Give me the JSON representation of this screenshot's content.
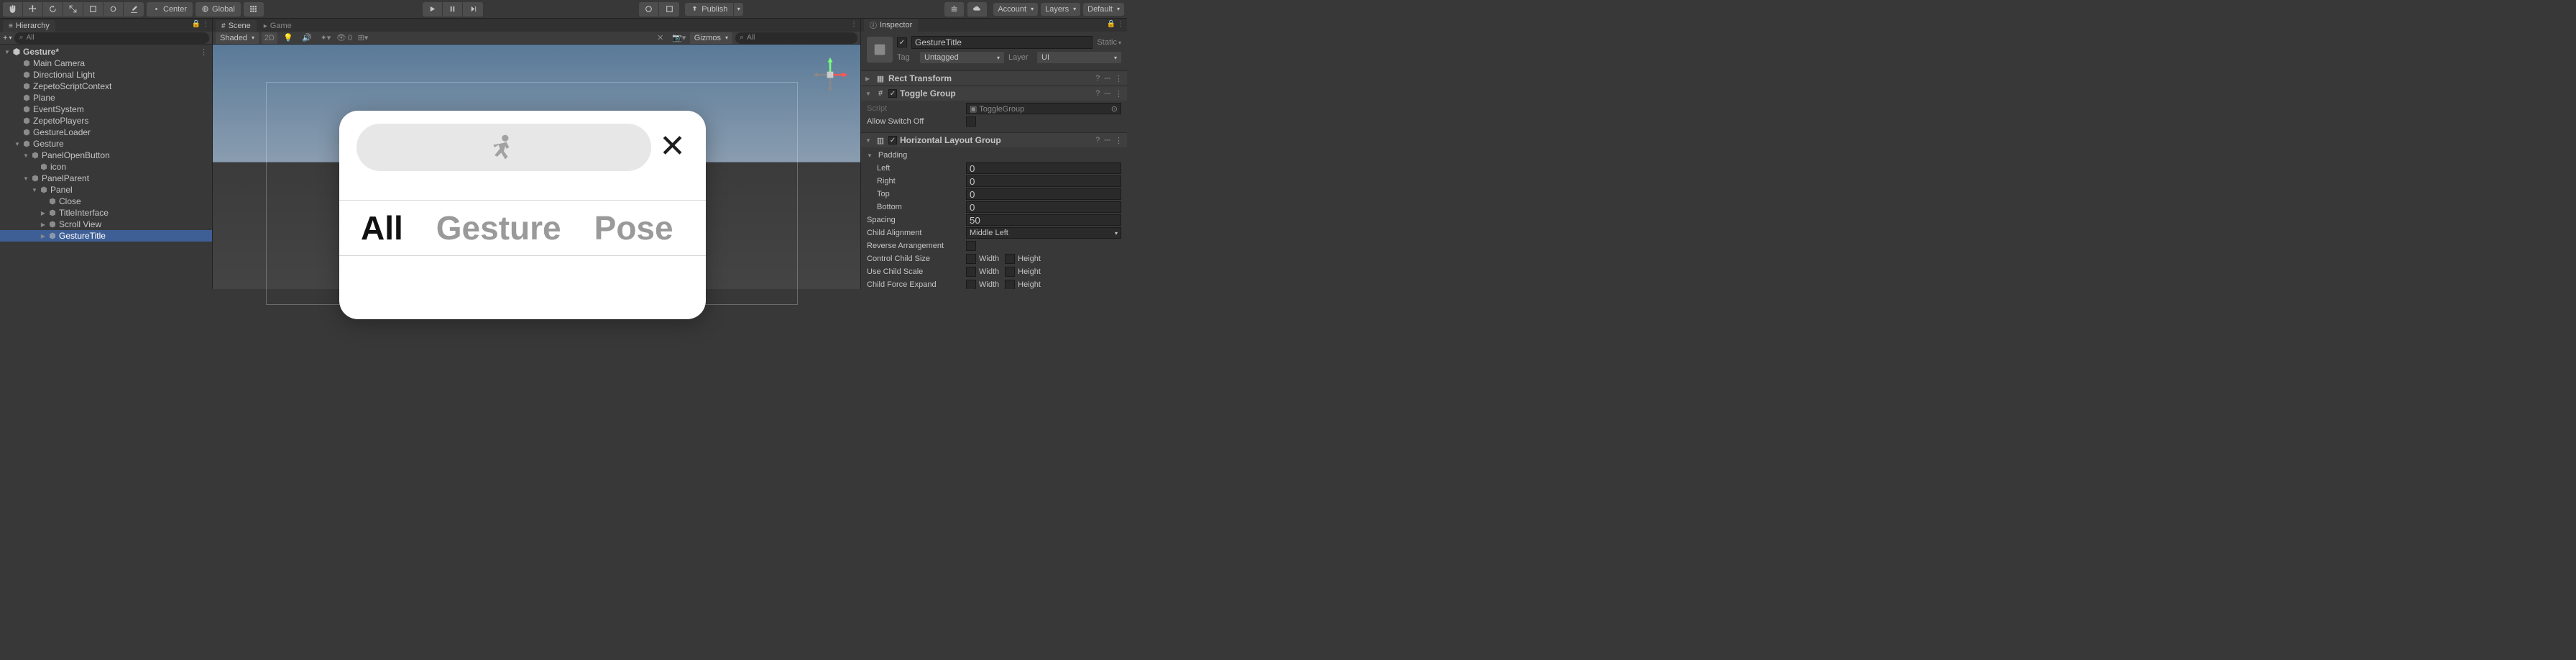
{
  "toolbar": {
    "center": "Center",
    "global": "Global",
    "publish": "Publish",
    "account": "Account",
    "layers": "Layers",
    "layout": "Default"
  },
  "hierarchy": {
    "tab": "Hierarchy",
    "search_placeholder": "All",
    "scene": "Gesture*",
    "items": [
      {
        "label": "Main Camera",
        "pad": 1
      },
      {
        "label": "Directional Light",
        "pad": 1
      },
      {
        "label": "ZepetoScriptContext",
        "pad": 1
      },
      {
        "label": "Plane",
        "pad": 1
      },
      {
        "label": "EventSystem",
        "pad": 1
      },
      {
        "label": "ZepetoPlayers",
        "pad": 1
      },
      {
        "label": "GestureLoader",
        "pad": 1
      },
      {
        "label": "Gesture",
        "pad": 1,
        "fold": true
      },
      {
        "label": "PanelOpenButton",
        "pad": 2,
        "fold": true
      },
      {
        "label": "icon",
        "pad": 3
      },
      {
        "label": "PanelParent",
        "pad": 2,
        "fold": true
      },
      {
        "label": "Panel",
        "pad": 3,
        "fold": true
      },
      {
        "label": "Close",
        "pad": 4
      },
      {
        "label": "TitleInterface",
        "pad": 4,
        "fold": false
      },
      {
        "label": "Scroll View",
        "pad": 4,
        "fold": false
      },
      {
        "label": "GestureTitle",
        "pad": 4,
        "fold": false,
        "selected": true
      }
    ]
  },
  "scene": {
    "tab_scene": "Scene",
    "tab_game": "Game",
    "shading": "Shaded",
    "mode2d": "2D",
    "lit": "0",
    "gizmos": "Gizmos",
    "search_placeholder": "All",
    "titles": {
      "all": "All",
      "gesture": "Gesture",
      "pose": "Pose"
    }
  },
  "inspector": {
    "tab": "Inspector",
    "name": "GestureTitle",
    "static": "Static",
    "tag_label": "Tag",
    "tag": "Untagged",
    "layer_label": "Layer",
    "layer": "UI",
    "components": {
      "rect": "Rect Transform",
      "toggle": "Toggle Group",
      "hlayout": "Horizontal Layout Group"
    },
    "toggle_group": {
      "script_label": "Script",
      "script_value": "ToggleGroup",
      "allow_label": "Allow Switch Off"
    },
    "hlayout": {
      "padding": "Padding",
      "left": "Left",
      "left_v": "0",
      "right": "Right",
      "right_v": "0",
      "top": "Top",
      "top_v": "0",
      "bottom": "Bottom",
      "bottom_v": "0",
      "spacing": "Spacing",
      "spacing_v": "50",
      "child_align": "Child Alignment",
      "child_align_v": "Middle Left",
      "reverse": "Reverse Arrangement",
      "control": "Control Child Size",
      "scale": "Use Child Scale",
      "expand": "Child Force Expand",
      "width": "Width",
      "height": "Height"
    }
  }
}
